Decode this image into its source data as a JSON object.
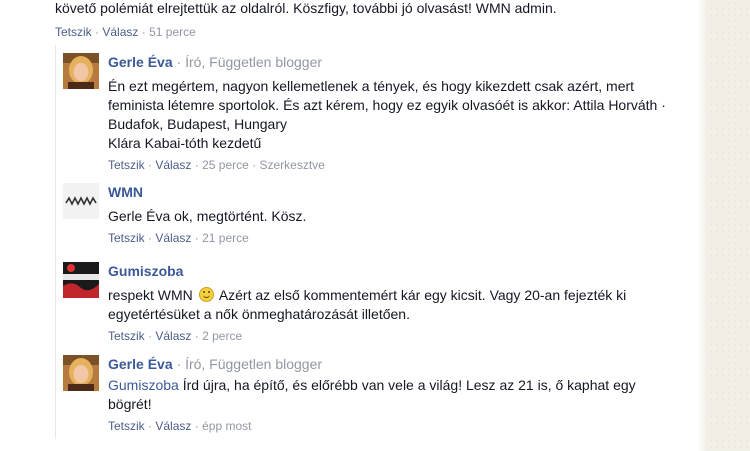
{
  "top": {
    "text": "követő polémiát elrejtettük az oldalról. Köszfigy, további jó olvasást! WMN admin.",
    "like": "Tetszik",
    "reply": "Válasz",
    "time": "51 perce"
  },
  "comments": [
    {
      "author": "Gerle Éva",
      "meta": "Író, Független blogger",
      "lines": [
        "Én ezt megértem, nagyon kellemetlenek a tények, és hogy kikezdett csak azért, mert",
        "feminista létemre sportolok. És azt kérem, hogy ez egyik olvasóét is akkor: Attila Horváth ·",
        "Budafok, Budapest, Hungary",
        "Klára Kabai-tóth kezdetű"
      ],
      "like": "Tetszik",
      "reply": "Válasz",
      "time": "25 perce",
      "edited": "Szerkesztve"
    },
    {
      "author": "WMN",
      "text": "Gerle Éva ok, megtörtént. Kösz.",
      "like": "Tetszik",
      "reply": "Válasz",
      "time": "21 perce",
      "avatar_text": "WMN"
    },
    {
      "author": "Gumiszoba",
      "text_before": "respekt WMN",
      "text_after": "Azért az első kommentemért kár egy kicsit. Vagy 20-an fejezték ki",
      "line2": "egyetértésüket a nők önmeghatározását illetően.",
      "like": "Tetszik",
      "reply": "Válasz",
      "time": "2 perce",
      "avatar_text": "GUMISZOBA"
    },
    {
      "author": "Gerle Éva",
      "meta": "Író, Független blogger",
      "mention": "Gumiszoba",
      "text": "Írd újra, ha építő, és előrébb van vele a világ! Lesz az 21 is, ő kaphat egy",
      "line2": "bögrét!",
      "like": "Tetszik",
      "reply": "Válasz",
      "time": "épp most"
    }
  ],
  "colors": {
    "link": "#3b5998",
    "action_link": "#4b5d8a",
    "meta": "#9197a3",
    "text": "#141823",
    "sidebar": "#f2efe6"
  }
}
